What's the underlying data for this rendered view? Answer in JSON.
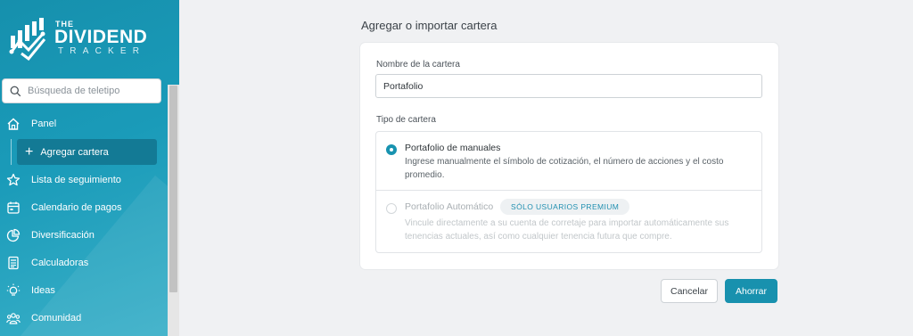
{
  "brand": {
    "the": "THE",
    "name": "DIVIDEND",
    "sub": "TRACKER"
  },
  "search": {
    "placeholder": "Búsqueda de teletipo"
  },
  "sidebar": {
    "items": [
      {
        "label": "Panel",
        "icon": "home-icon"
      },
      {
        "label": "Lista de seguimiento",
        "icon": "star-icon"
      },
      {
        "label": "Calendario de pagos",
        "icon": "calendar-icon"
      },
      {
        "label": "Diversificación",
        "icon": "pie-chart-icon"
      },
      {
        "label": "Calculadoras",
        "icon": "calculator-icon"
      },
      {
        "label": "Ideas",
        "icon": "lightbulb-icon"
      },
      {
        "label": "Comunidad",
        "icon": "community-icon"
      }
    ],
    "sub_item": {
      "label": "Agregar cartera",
      "icon": "plus-icon"
    }
  },
  "main": {
    "title": "Agregar o importar cartera",
    "name_label": "Nombre de la cartera",
    "name_value": "Portafolio",
    "type_label": "Tipo de cartera",
    "options": [
      {
        "title": "Portafolio de manuales",
        "description": "Ingrese manualmente el símbolo de cotización, el número de acciones y el costo promedio.",
        "selected": true
      },
      {
        "title": "Portafolio Automático",
        "badge": "SÓLO USUARIOS PREMIUM",
        "description": "Vincule directamente a su cuenta de corretaje para importar automáticamente sus tenencias actuales, así como cualquier tenencia futura que compre.",
        "selected": false
      }
    ],
    "cancel_label": "Cancelar",
    "save_label": "Ahorrar"
  },
  "colors": {
    "sidebar": "#1a9bb9",
    "accent": "#1891ae",
    "active_nav": "#137a95",
    "background": "#f0f1f3"
  }
}
